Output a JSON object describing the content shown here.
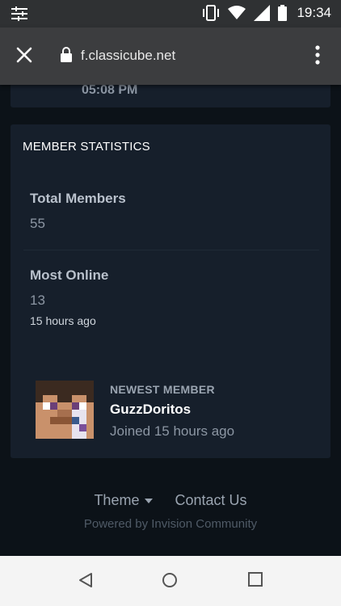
{
  "status_bar": {
    "time": "19:34",
    "icons": [
      "sliders-icon",
      "vibrate-icon",
      "wifi-icon",
      "signal-icon",
      "battery-icon"
    ]
  },
  "browser": {
    "url": "f.classicube.net",
    "icons": [
      "close-icon",
      "lock-icon",
      "more-vert-icon"
    ]
  },
  "prev_card": {
    "cut_text": "05:08 PM"
  },
  "member_statistics": {
    "title": "MEMBER STATISTICS",
    "total_members_label": "Total Members",
    "total_members_value": "55",
    "most_online_label": "Most Online",
    "most_online_value": "13",
    "most_online_time": "15 hours ago",
    "newest_member_label": "NEWEST MEMBER",
    "newest_member_name": "GuzzDoritos",
    "newest_member_joined": "Joined 15 hours ago"
  },
  "footer": {
    "theme_label": "Theme",
    "contact_label": "Contact Us",
    "powered_by": "Powered by Invision Community"
  },
  "nav_bar": {
    "icons": [
      "back-icon",
      "home-icon",
      "recents-icon"
    ]
  },
  "colors": {
    "page_bg": "#0c1218",
    "card_bg": "#161f2b",
    "muted_text": "#8c96a3",
    "label_text": "#b9c1cc"
  }
}
